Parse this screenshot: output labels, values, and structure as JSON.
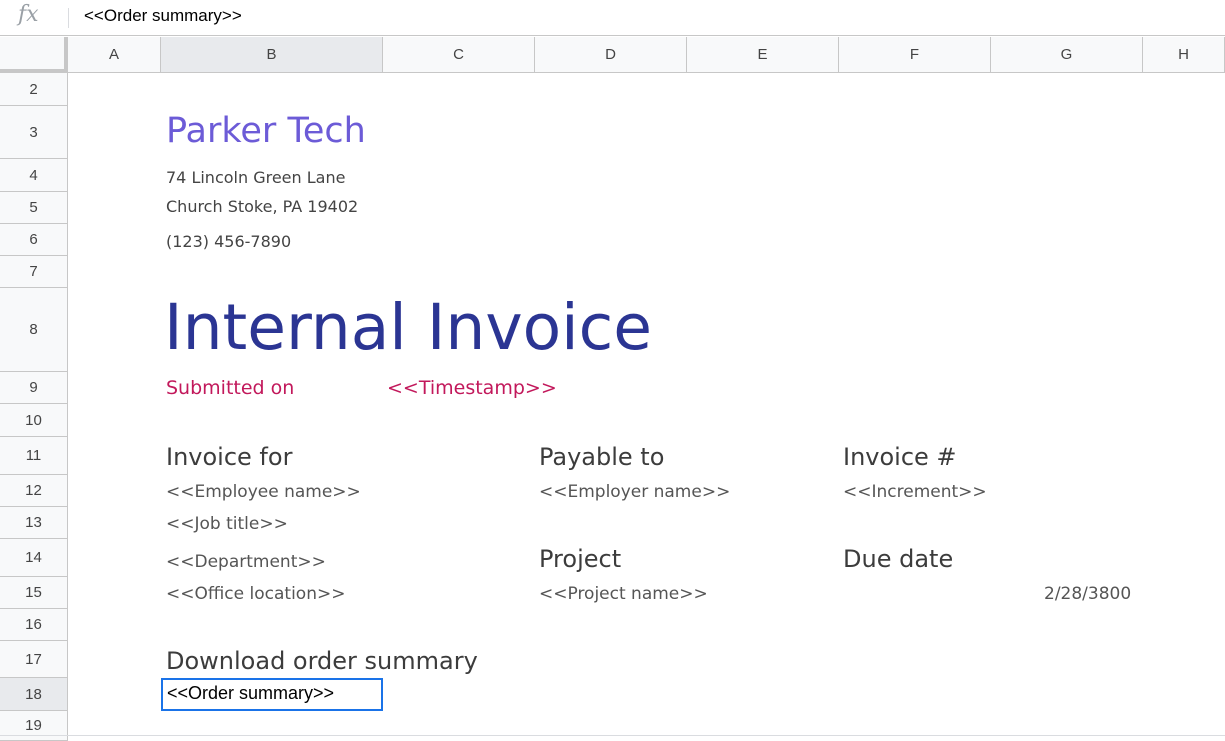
{
  "formula_bar": {
    "fx_icon": "fx-icon",
    "value": "<<Order summary>>"
  },
  "columns": [
    "A",
    "B",
    "C",
    "D",
    "E",
    "F",
    "G",
    "H"
  ],
  "rows": [
    "2",
    "3",
    "4",
    "5",
    "6",
    "7",
    "8",
    "9",
    "10",
    "11",
    "12",
    "13",
    "14",
    "15",
    "16",
    "17",
    "18",
    "19"
  ],
  "invoice": {
    "company": "Parker Tech",
    "address_line1": "74 Lincoln Green Lane",
    "address_line2": "Church Stoke, PA 19402",
    "phone": "(123) 456-7890",
    "title": "Internal Invoice",
    "submitted_label": "Submitted on",
    "timestamp": "<<Timestamp>>",
    "invoice_for_label": "Invoice for",
    "employee_name": "<<Employee name>>",
    "job_title": "<<Job title>>",
    "department": "<<Department>>",
    "office_location": "<<Office location>>",
    "payable_to_label": "Payable to",
    "employer_name": "<<Employer name>>",
    "project_label": "Project",
    "project_name": "<<Project name>>",
    "invoice_no_label": "Invoice #",
    "increment": "<<Increment>>",
    "due_date_label": "Due date",
    "due_date_value": "2/28/3800",
    "download_label": "Download order summary",
    "order_summary": "<<Order summary>>"
  },
  "colors": {
    "company": "#6c5bd7",
    "title": "#2b3593",
    "submitted": "#c2185b",
    "selection": "#1a73e8"
  }
}
